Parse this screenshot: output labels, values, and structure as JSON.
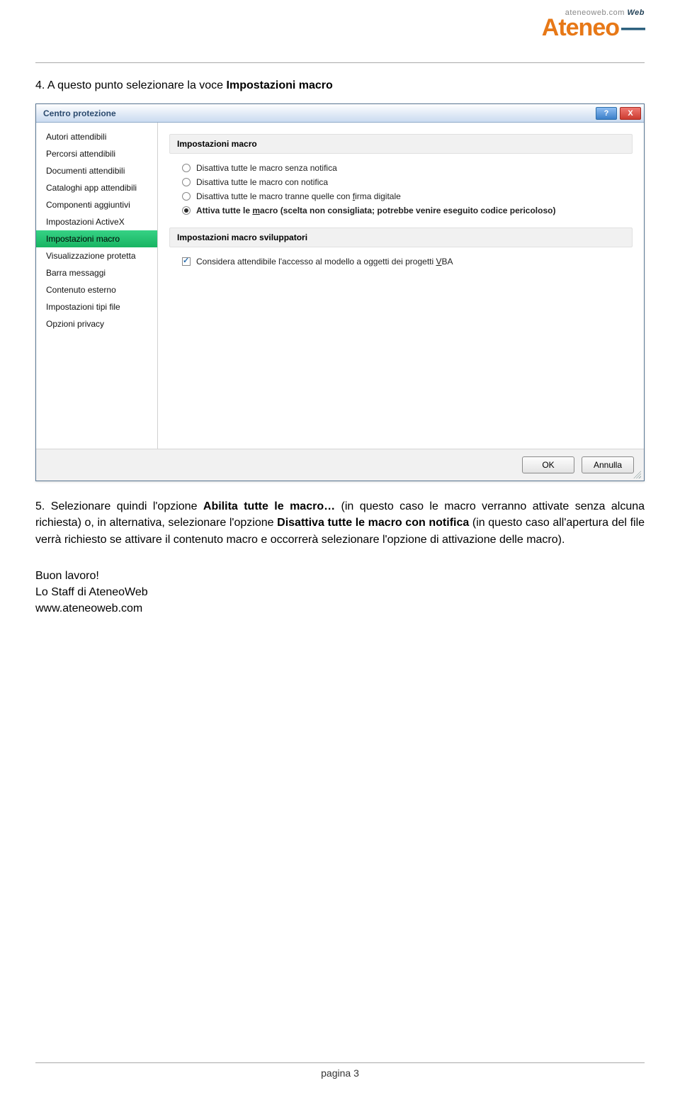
{
  "logo": {
    "top_text": "ateneoweb.com",
    "top_web": "Web",
    "main": "Ateneo",
    "dash": "—"
  },
  "doc": {
    "step4": "4. A questo punto selezionare la voce ",
    "step4_bold": "Impostazioni macro",
    "step5_a": "5. Selezionare quindi l'opzione ",
    "step5_bold1": "Abilita tutte le macro…",
    "step5_b": " (in questo caso le macro verranno attivate senza alcuna richiesta) o, in alternativa, selezionare l'opzione ",
    "step5_bold2": "Disattiva tutte le macro con notifica",
    "step5_c": " (in questo caso all'apertura del file verrà richiesto se attivare il contenuto macro e occorrerà selezionare l'opzione di attivazione delle macro).",
    "signoff1": "Buon lavoro!",
    "signoff2": "Lo Staff di AteneoWeb",
    "signoff3": "www.ateneoweb.com",
    "page_label": "pagina 3"
  },
  "dialog": {
    "title": "Centro protezione",
    "help": "?",
    "close": "X",
    "sidebar": [
      "Autori attendibili",
      "Percorsi attendibili",
      "Documenti attendibili",
      "Cataloghi app attendibili",
      "Componenti aggiuntivi",
      "Impostazioni ActiveX",
      "Impostazioni macro",
      "Visualizzazione protetta",
      "Barra messaggi",
      "Contenuto esterno",
      "Impostazioni tipi file",
      "Opzioni privacy"
    ],
    "selected_index": 6,
    "section1": "Impostazioni macro",
    "radios": {
      "r0": "Disattiva tutte le macro senza notifica",
      "r1": "Disattiva tutte le macro con notifica",
      "r2_a": "Disattiva tutte le macro tranne quelle con ",
      "r2_u": "f",
      "r2_b": "irma digitale",
      "r3_a": "Attiva tutte le ",
      "r3_u": "m",
      "r3_b": "acro (scelta non consigliata; potrebbe venire eseguito codice pericoloso)"
    },
    "section2": "Impostazioni macro sviluppatori",
    "chk_a": "Considera attendibile l'accesso al modello a oggetti dei progetti ",
    "chk_u": "V",
    "chk_b": "BA",
    "ok": "OK",
    "cancel": "Annulla"
  }
}
